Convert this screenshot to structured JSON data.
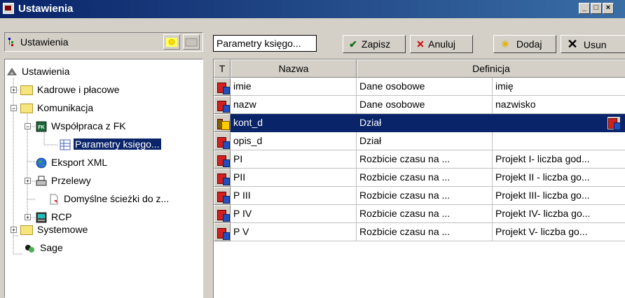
{
  "window": {
    "title": "Ustawienia"
  },
  "left_panel": {
    "header_label": "Ustawienia",
    "tree": [
      {
        "label": "Ustawienia"
      },
      {
        "label": "Kadrowe i płacowe"
      },
      {
        "label": "Komunikacja"
      },
      {
        "label": "Współpraca z FK"
      },
      {
        "label": "Parametry księgo..."
      },
      {
        "label": "Eksport XML"
      },
      {
        "label": "Przelewy"
      },
      {
        "label": "Domyślne ścieżki do z..."
      },
      {
        "label": "RCP"
      },
      {
        "label": "Systemowe"
      },
      {
        "label": "Sage"
      }
    ]
  },
  "toolbar": {
    "selector_value": "Parametry księgo...",
    "save_label": "Zapisz",
    "cancel_label": "Anuluj",
    "add_label": "Dodaj",
    "delete_label": "Usun"
  },
  "grid": {
    "columns": {
      "t": "T",
      "name": "Nazwa",
      "definition": "Definicja"
    },
    "rows": [
      {
        "icon": "report-icon",
        "name": "imie",
        "def1": "Dane osobowe",
        "def2": "imię"
      },
      {
        "icon": "report-icon",
        "name": "nazw",
        "def1": "Dane osobowe",
        "def2": "nazwisko"
      },
      {
        "icon": "dictionary-icon",
        "name": "kont_d",
        "def1": "Dział",
        "def2": ""
      },
      {
        "icon": "report-icon",
        "name": "opis_d",
        "def1": "Dział",
        "def2": ""
      },
      {
        "icon": "report-icon",
        "name": "PI",
        "def1": "Rozbicie czasu na ...",
        "def2": "Projekt I- liczba god..."
      },
      {
        "icon": "report-icon",
        "name": "PII",
        "def1": "Rozbicie czasu na ...",
        "def2": "Projekt II - liczba go..."
      },
      {
        "icon": "report-icon",
        "name": "P III",
        "def1": "Rozbicie czasu na ...",
        "def2": "Projekt III- liczba go..."
      },
      {
        "icon": "report-icon",
        "name": "P IV",
        "def1": "Rozbicie czasu na ...",
        "def2": "Projekt IV- liczba go..."
      },
      {
        "icon": "report-icon",
        "name": "P V",
        "def1": "Rozbicie czasu na ...",
        "def2": "Projekt V- liczba go..."
      }
    ]
  },
  "colors": {
    "title_bar": "#0a246a",
    "selection": "#0a246a",
    "face": "#d4d0c8"
  }
}
